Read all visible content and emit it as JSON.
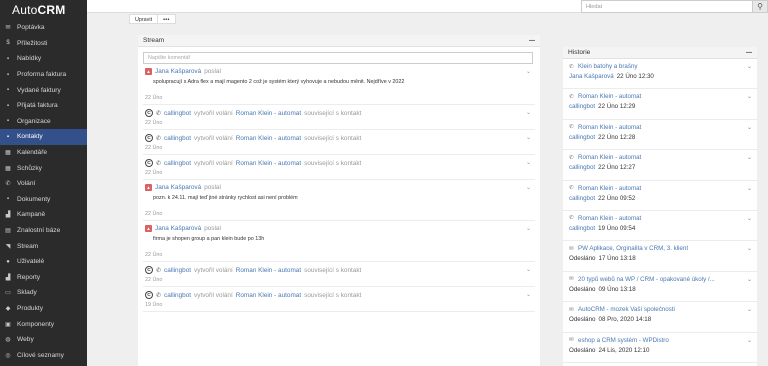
{
  "app": {
    "logo_prefix": "Auto",
    "logo_suffix": "CRM"
  },
  "sidebar": {
    "items": [
      {
        "label": "Poptávka",
        "icon": "inbox-icon",
        "glyph": "✉"
      },
      {
        "label": "Příležitosti",
        "icon": "dollar-icon",
        "glyph": "$"
      },
      {
        "label": "Nabídky",
        "icon": "document-icon",
        "glyph": "▪"
      },
      {
        "label": "Proforma faktura",
        "icon": "document-icon",
        "glyph": "▪"
      },
      {
        "label": "Vydané faktury",
        "icon": "invoice-icon",
        "glyph": "▪"
      },
      {
        "label": "Přijatá faktura",
        "icon": "invoice-icon",
        "glyph": "▪"
      },
      {
        "label": "Organizace",
        "icon": "building-icon",
        "glyph": "▪"
      },
      {
        "label": "Kontakty",
        "icon": "contact-icon",
        "glyph": "▪",
        "active": true
      },
      {
        "label": "Kalendáře",
        "icon": "calendar-icon",
        "glyph": "▦"
      },
      {
        "label": "Schůzky",
        "icon": "meeting-icon",
        "glyph": "▦"
      },
      {
        "label": "Volání",
        "icon": "phone-icon",
        "glyph": "✆"
      },
      {
        "label": "Dokumenty",
        "icon": "file-icon",
        "glyph": "▪"
      },
      {
        "label": "Kampaně",
        "icon": "chart-icon",
        "glyph": "▟"
      },
      {
        "label": "Znalostní báze",
        "icon": "book-icon",
        "glyph": "▤"
      },
      {
        "label": "Stream",
        "icon": "rss-icon",
        "glyph": "◥"
      },
      {
        "label": "Uživatelé",
        "icon": "user-icon",
        "glyph": "●"
      },
      {
        "label": "Reporty",
        "icon": "report-icon",
        "glyph": "▟"
      },
      {
        "label": "Sklady",
        "icon": "warehouse-icon",
        "glyph": "▭"
      },
      {
        "label": "Produkty",
        "icon": "product-icon",
        "glyph": "◆"
      },
      {
        "label": "Komponenty",
        "icon": "component-icon",
        "glyph": "▣"
      },
      {
        "label": "Weby",
        "icon": "globe-icon",
        "glyph": "◍"
      },
      {
        "label": "Cílové seznamy",
        "icon": "target-icon",
        "glyph": "◎"
      }
    ]
  },
  "search": {
    "placeholder": "Hledat"
  },
  "actions": {
    "edit_label": "Upravit",
    "more_label": "•••"
  },
  "stream": {
    "title": "Stream",
    "menu_label": "—",
    "comment_placeholder": "Napište komentář",
    "posts": [
      {
        "kind": "post",
        "user": "Jana Kašparová",
        "verb": "poslal",
        "text": "spolupracují s Adra flex a mají magento 2 což je systém který vyhovuje a nebudou měnit. Nejdříve v 2022",
        "date": "22 Úno"
      },
      {
        "kind": "call",
        "user": "callingbot",
        "verb": "vytvořil volání",
        "target": "Roman Klein - automat",
        "tail": "související s kontakt",
        "date": "22 Úno"
      },
      {
        "kind": "call",
        "user": "callingbot",
        "verb": "vytvořil volání",
        "target": "Roman Klein - automat",
        "tail": "související s kontakt",
        "date": "22 Úno"
      },
      {
        "kind": "call",
        "user": "callingbot",
        "verb": "vytvořil volání",
        "target": "Roman Klein - automat",
        "tail": "související s kontakt",
        "date": "22 Úno"
      },
      {
        "kind": "post",
        "user": "Jana Kašparová",
        "verb": "poslal",
        "text": "pozn. k 24.11. mají teď jiné stránky rychlost asi není problém",
        "date": "22 Úno"
      },
      {
        "kind": "post",
        "user": "Jana Kašparová",
        "verb": "poslal",
        "text": "firma je shopen group a pan klein bude po 13h",
        "date": "22 Úno"
      },
      {
        "kind": "call",
        "user": "callingbot",
        "verb": "vytvořil volání",
        "target": "Roman Klein - automat",
        "tail": "související s kontakt",
        "date": "22 Úno"
      },
      {
        "kind": "call",
        "user": "callingbot",
        "verb": "vytvořil volání",
        "target": "Roman Klein - automat",
        "tail": "související s kontakt",
        "date": "19 Úno"
      }
    ]
  },
  "history": {
    "title": "Historie",
    "menu_label": "—",
    "items": [
      {
        "icon": "phone-icon",
        "glyph": "✆",
        "title": "Klein batohy a brašny",
        "user": "Jana Kašparová",
        "date": "22 Úno 12:30"
      },
      {
        "icon": "phone-icon",
        "glyph": "✆",
        "title": "Roman Klein - automat",
        "user": "callingbot",
        "date": "22 Úno 12:29"
      },
      {
        "icon": "phone-icon",
        "glyph": "✆",
        "title": "Roman Klein - automat",
        "user": "callingbot",
        "date": "22 Úno 12:28"
      },
      {
        "icon": "phone-icon",
        "glyph": "✆",
        "title": "Roman Klein - automat",
        "user": "callingbot",
        "date": "22 Úno 12:27"
      },
      {
        "icon": "phone-icon",
        "glyph": "✆",
        "title": "Roman Klein - automat",
        "user": "callingbot",
        "date": "22 Úno 09:52"
      },
      {
        "icon": "phone-icon",
        "glyph": "✆",
        "title": "Roman Klein - automat",
        "user": "callingbot",
        "date": "19 Úno 09:54"
      },
      {
        "icon": "email-icon",
        "glyph": "✉",
        "title": "PW Aplikace, Orginalita v CRM, 3. klient",
        "status": "Odesláno",
        "date": "17 Úno 13:18"
      },
      {
        "icon": "email-icon",
        "glyph": "✉",
        "title": "20 typů webů na WP / CRM - opakované úkoly /...",
        "status": "Odesláno",
        "date": "09 Úno 13:18"
      },
      {
        "icon": "email-icon",
        "glyph": "✉",
        "title": "AutoCRM - mozek Vaší společnosti",
        "status": "Odesláno",
        "date": "08 Pro, 2020 14:18"
      },
      {
        "icon": "email-icon",
        "glyph": "✉",
        "title": "eshop a CRM systém - WPDistro",
        "status": "Odesláno",
        "date": "24 Lis, 2020 12:10"
      }
    ]
  },
  "colors": {
    "sidebar_bg": "#2b2b2b",
    "active_item": "#34508a",
    "link": "#4a79b3",
    "avatar": "#d96262"
  }
}
